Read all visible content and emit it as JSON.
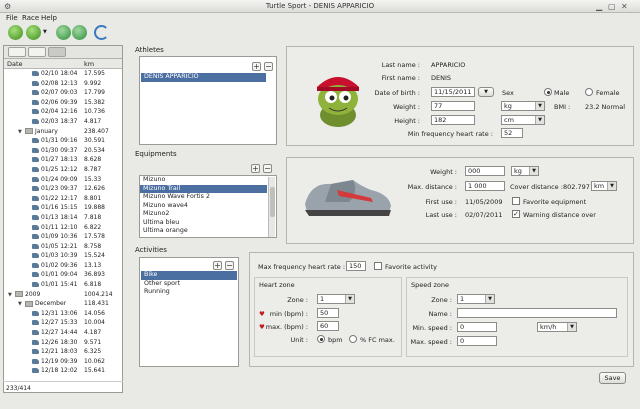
{
  "window": {
    "title": "Turtle Sport - DENIS APPARICIO"
  },
  "menu": [
    "File",
    "Race",
    "Help"
  ],
  "left": {
    "columns": {
      "date": "Date",
      "km": "km"
    },
    "rows": [
      {
        "type": "run",
        "date": "02/10 18:04",
        "km": "17.595"
      },
      {
        "type": "run",
        "date": "02/08 12:13",
        "km": "9.992"
      },
      {
        "type": "run",
        "date": "02/07 09:03",
        "km": "17.799"
      },
      {
        "type": "run",
        "date": "02/06 09:39",
        "km": "15.382"
      },
      {
        "type": "run",
        "date": "02/04 12:16",
        "km": "10.736"
      },
      {
        "type": "run",
        "date": "02/03 18:37",
        "km": "4.817"
      },
      {
        "type": "month",
        "date": "January",
        "km": "238.407"
      },
      {
        "type": "run",
        "date": "01/31 09:16",
        "km": "30.591"
      },
      {
        "type": "run",
        "date": "01/30 09:37",
        "km": "20.534"
      },
      {
        "type": "run",
        "date": "01/27 18:13",
        "km": "8.628"
      },
      {
        "type": "run",
        "date": "01/25 12:12",
        "km": "8.787"
      },
      {
        "type": "run",
        "date": "01/24 09:09",
        "km": "15.33"
      },
      {
        "type": "run",
        "date": "01/23 09:37",
        "km": "12.626"
      },
      {
        "type": "run",
        "date": "01/22 12:17",
        "km": "8.801"
      },
      {
        "type": "run",
        "date": "01/16 15:15",
        "km": "19.888"
      },
      {
        "type": "run",
        "date": "01/13 18:14",
        "km": "7.818"
      },
      {
        "type": "run",
        "date": "01/11 12:10",
        "km": "6.822"
      },
      {
        "type": "run",
        "date": "01/09 10:36",
        "km": "17.578"
      },
      {
        "type": "run",
        "date": "01/05 12:21",
        "km": "8.758"
      },
      {
        "type": "run",
        "date": "01/03 10:39",
        "km": "15.524"
      },
      {
        "type": "run",
        "date": "01/02 09:36",
        "km": "13.13"
      },
      {
        "type": "run",
        "date": "01/01 09:04",
        "km": "36.893"
      },
      {
        "type": "run",
        "date": "01/01 15:41",
        "km": "6.818"
      },
      {
        "type": "year",
        "date": "2009",
        "km": "1004.214"
      },
      {
        "type": "month",
        "date": "December",
        "km": "118.431"
      },
      {
        "type": "run",
        "date": "12/31 13:06",
        "km": "14.056"
      },
      {
        "type": "run",
        "date": "12/27 15:33",
        "km": "10.004"
      },
      {
        "type": "run",
        "date": "12/27 14:44",
        "km": "4.187"
      },
      {
        "type": "run",
        "date": "12/26 18:30",
        "km": "9.571"
      },
      {
        "type": "run",
        "date": "12/21 18:03",
        "km": "6.325"
      },
      {
        "type": "run",
        "date": "12/19 09:39",
        "km": "10.062"
      },
      {
        "type": "run",
        "date": "12/18 12:02",
        "km": "15.641"
      }
    ],
    "status": "233/414"
  },
  "athletes": {
    "title": "Athletes",
    "items": [
      "DENIS APPARICIO"
    ],
    "last_name_label": "Last name :",
    "last_name": "APPARICIO",
    "first_name_label": "First name :",
    "first_name": "DENIS",
    "dob_label": "Date of birth :",
    "dob": "11/15/2011",
    "sex_label": "Sex",
    "male": "Male",
    "female": "Female",
    "weight_label": "Weight :",
    "weight": "77",
    "weight_unit": "kg",
    "bmi_label": "BMI :",
    "bmi": "23.2 Normal",
    "height_label": "Height :",
    "height": "182",
    "height_unit": "cm",
    "maxhr_label": "Min frequency heart rate :",
    "maxhr": "52"
  },
  "equipments": {
    "title": "Equipments",
    "items": [
      "Mizuno",
      "Mizuno Trail",
      "Mizuno Wave Fortis 2",
      "Mizuno wave4",
      "Mizuno2",
      "Ultima bleu",
      "Ultima orange"
    ],
    "selected": 1,
    "weight_label": "Weight :",
    "weight": "000",
    "weight_unit": "kg",
    "max_dist_label": "Max. distance :",
    "max_dist": "1 000",
    "cover_label": "Cover distance :",
    "cover": "802.797",
    "cover_unit": "km",
    "first_use_label": "First use :",
    "first_use": "11/05/2009",
    "favorite_label": "Favorite equipment",
    "last_use_label": "Last use :",
    "last_use": "02/07/2011",
    "warning_label": "Warning distance over"
  },
  "activities": {
    "title": "Activities",
    "items": [
      "Bike",
      "Other sport",
      "Running"
    ],
    "selected": 0,
    "maxhr_label": "Max frequency heart rate :",
    "maxhr": "150",
    "fav_label": "Favorite activity",
    "heart_zone": {
      "title": "Heart zone",
      "zone_label": "Zone :",
      "zone": "1",
      "min_label": "min  (bpm) :",
      "min": "50",
      "max_label": "max.  (bpm) :",
      "max": "60",
      "unit_label": "Unit :",
      "bpm": "bpm",
      "fc": "% FC max."
    },
    "speed_zone": {
      "title": "Speed zone",
      "zone_label": "Zone :",
      "zone": "1",
      "name_label": "Name :",
      "name": "",
      "min_label": "Min. speed :",
      "min": "0",
      "unit": "km/h",
      "max_label": "Max. speed :",
      "max": "0"
    }
  },
  "save_label": "Save"
}
